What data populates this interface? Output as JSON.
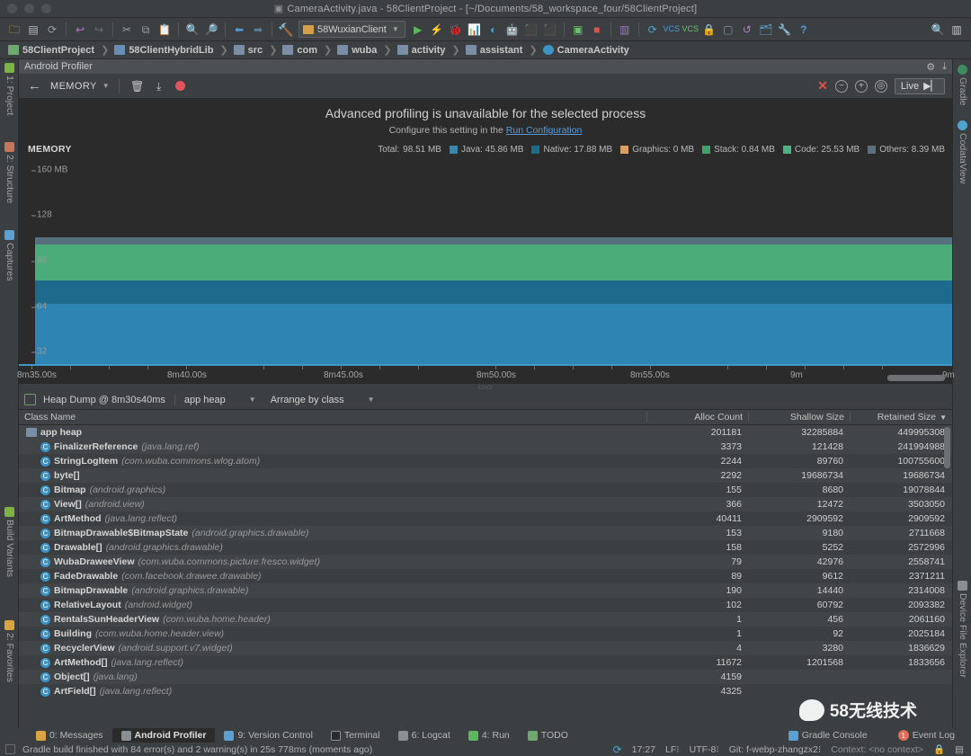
{
  "window": {
    "title": "CameraActivity.java - 58ClientProject - [~/Documents/58_workspace_four/58ClientProject]",
    "doc_icon": "document-icon"
  },
  "toolbar": {
    "icons": [
      "open-folder-icon",
      "save-icon",
      "sync-icon",
      "undo-icon",
      "redo-icon",
      "cut-icon",
      "copy-icon",
      "paste-icon",
      "find-icon",
      "find-replace-icon",
      "back-icon",
      "forward-icon",
      "build-icon"
    ],
    "run_config": "58WuxianClient",
    "right_icons": [
      "search-icon",
      "avatar-icon"
    ],
    "action_icons": [
      "run-icon",
      "apply-changes-icon",
      "debug-icon",
      "profile-icon",
      "monitor-icon",
      "android-icon",
      "sdk-manager-icon",
      "avd-manager-icon",
      "stop-icon",
      "layout-inspector-icon",
      "sync-gradle-icon",
      "vcs-update-icon",
      "vcs-commit-icon",
      "lock-icon",
      "device-icon",
      "revert-icon",
      "project-structure-icon",
      "settings-icon",
      "help-icon"
    ]
  },
  "breadcrumb": [
    {
      "label": "58ClientProject",
      "icon": "module-icon"
    },
    {
      "label": "58ClientHybridLib",
      "icon": "library-icon"
    },
    {
      "label": "src",
      "icon": "source-folder-icon"
    },
    {
      "label": "com",
      "icon": "folder-icon"
    },
    {
      "label": "wuba",
      "icon": "folder-icon"
    },
    {
      "label": "activity",
      "icon": "folder-icon"
    },
    {
      "label": "assistant",
      "icon": "folder-icon"
    },
    {
      "label": "CameraActivity",
      "icon": "class-icon"
    }
  ],
  "left_rail": [
    {
      "label": "1: Project",
      "icon": "project-icon"
    },
    {
      "label": "2: Structure",
      "icon": "structure-icon"
    },
    {
      "label": "Captures",
      "icon": "captures-icon"
    },
    {
      "label": "Build Variants",
      "icon": "build-variants-icon"
    },
    {
      "label": "2: Favorites",
      "icon": "favorites-icon"
    }
  ],
  "right_rail": [
    {
      "label": "Gradle",
      "icon": "gradle-icon"
    },
    {
      "label": "CodataView",
      "icon": "codata-icon"
    },
    {
      "label": "Device File Explorer",
      "icon": "device-file-explorer-icon"
    }
  ],
  "panel": {
    "title": "Android Profiler",
    "gear_icon": "settings-icon",
    "hide_icon": "hide-icon"
  },
  "profiler_toolbar": {
    "back_icon": "back-arrow-icon",
    "mode": "MEMORY",
    "dropdown_icon": "chevron-down-icon",
    "trash_icon": "trash-icon",
    "export_icon": "export-heap-dump-icon",
    "record_icon": "record-icon",
    "close_icon": "close-icon",
    "zoom_out_icon": "zoom-out-icon",
    "zoom_in_icon": "zoom-in-icon",
    "reset_zoom_icon": "reset-zoom-icon",
    "live_label": "Live",
    "live_icon": "go-live-icon"
  },
  "banner": {
    "message": "Advanced profiling is unavailable for the selected process",
    "hint_prefix": "Configure this setting in the ",
    "hint_link": "Run Configuration"
  },
  "chart_data": {
    "type": "area",
    "title": "MEMORY",
    "xlabel": "",
    "ylabel": "MB",
    "ylim": [
      0,
      160
    ],
    "yticks": [
      160,
      128,
      96,
      64,
      32
    ],
    "ytick_labels": [
      "160 MB",
      "128",
      "96",
      "64",
      "32"
    ],
    "xticks": [
      "8m35.00s",
      "8m40.00s",
      "8m45.00s",
      "8m50.00s",
      "8m55.00s",
      "9m",
      "9m"
    ],
    "grid": false,
    "legend_position": "top-right",
    "total_label": "Total:",
    "total_value": "98.51 MB",
    "series": [
      {
        "name": "Java",
        "label": "Java: 45.86 MB",
        "value": 45.86,
        "color": "#3d85a8"
      },
      {
        "name": "Native",
        "label": "Native: 17.88 MB",
        "value": 17.88,
        "color": "#1b6c8c"
      },
      {
        "name": "Graphics",
        "label": "Graphics: 0 MB",
        "value": 0,
        "color": "#d9a066"
      },
      {
        "name": "Stack",
        "label": "Stack: 0.84 MB",
        "value": 0.84,
        "color": "#43a06f"
      },
      {
        "name": "Code",
        "label": "Code: 25.53 MB",
        "value": 25.53,
        "color": "#4fb083"
      },
      {
        "name": "Others",
        "label": "Others: 8.39 MB",
        "value": 8.39,
        "color": "#5b7080"
      }
    ],
    "stack_bands": [
      {
        "name": "Java",
        "from": 0,
        "to": 47,
        "color": "#2e84b3"
      },
      {
        "name": "Native",
        "from": 47,
        "to": 65,
        "color": "#1d6a8c"
      },
      {
        "name": "Code",
        "from": 65,
        "to": 93,
        "color": "#4bab79"
      },
      {
        "name": "Others",
        "from": 93,
        "to": 98,
        "color": "#56707e"
      }
    ]
  },
  "heap_bar": {
    "icon": "heap-dump-icon",
    "title": "Heap Dump @ 8m30s40ms",
    "heap_select": "app heap",
    "arrange_select": "Arrange by class",
    "caret_icon": "chevron-down-icon"
  },
  "table": {
    "columns": [
      "Class Name",
      "Alloc Count",
      "Shallow Size",
      "Retained Size"
    ],
    "sorted_column": "Retained Size",
    "sort_icon": "sort-desc-icon",
    "root": {
      "name": "app heap",
      "alloc": "201181",
      "shallow": "32285884",
      "retained": "449995308",
      "icon": "heap-folder-icon"
    },
    "rows": [
      {
        "name": "FinalizerReference",
        "pkg": "(java.lang.ref)",
        "alloc": "3373",
        "shallow": "121428",
        "retained": "241994988"
      },
      {
        "name": "StringLogItem",
        "pkg": "(com.wuba.commons.wlog.atom)",
        "alloc": "2244",
        "shallow": "89760",
        "retained": "100755600"
      },
      {
        "name": "byte[]",
        "pkg": "",
        "alloc": "2292",
        "shallow": "19686734",
        "retained": "19686734"
      },
      {
        "name": "Bitmap",
        "pkg": "(android.graphics)",
        "alloc": "155",
        "shallow": "8680",
        "retained": "19078844"
      },
      {
        "name": "View[]",
        "pkg": "(android.view)",
        "alloc": "366",
        "shallow": "12472",
        "retained": "3503050"
      },
      {
        "name": "ArtMethod",
        "pkg": "(java.lang.reflect)",
        "alloc": "40411",
        "shallow": "2909592",
        "retained": "2909592"
      },
      {
        "name": "BitmapDrawable$BitmapState",
        "pkg": "(android.graphics.drawable)",
        "alloc": "153",
        "shallow": "9180",
        "retained": "2711668"
      },
      {
        "name": "Drawable[]",
        "pkg": "(android.graphics.drawable)",
        "alloc": "158",
        "shallow": "5252",
        "retained": "2572996"
      },
      {
        "name": "WubaDraweeView",
        "pkg": "(com.wuba.commons.picture.fresco.widget)",
        "alloc": "79",
        "shallow": "42976",
        "retained": "2558741"
      },
      {
        "name": "FadeDrawable",
        "pkg": "(com.facebook.drawee.drawable)",
        "alloc": "89",
        "shallow": "9612",
        "retained": "2371211"
      },
      {
        "name": "BitmapDrawable",
        "pkg": "(android.graphics.drawable)",
        "alloc": "190",
        "shallow": "14440",
        "retained": "2314008"
      },
      {
        "name": "RelativeLayout",
        "pkg": "(android.widget)",
        "alloc": "102",
        "shallow": "60792",
        "retained": "2093382"
      },
      {
        "name": "RentalsSunHeaderView",
        "pkg": "(com.wuba.home.header)",
        "alloc": "1",
        "shallow": "456",
        "retained": "2061160"
      },
      {
        "name": "Building",
        "pkg": "(com.wuba.home.header.view)",
        "alloc": "1",
        "shallow": "92",
        "retained": "2025184"
      },
      {
        "name": "RecyclerView",
        "pkg": "(android.support.v7.widget)",
        "alloc": "4",
        "shallow": "3280",
        "retained": "1836629"
      },
      {
        "name": "ArtMethod[]",
        "pkg": "(java.lang.reflect)",
        "alloc": "11672",
        "shallow": "1201568",
        "retained": "1833656"
      },
      {
        "name": "Object[]",
        "pkg": "(java.lang)",
        "alloc": "4159",
        "shallow": "",
        "retained": ""
      },
      {
        "name": "ArtField[]",
        "pkg": "(java.lang.reflect)",
        "alloc": "4325",
        "shallow": "",
        "retained": ""
      }
    ]
  },
  "bottom_tabs": [
    {
      "key": "0",
      "label": "0: Messages",
      "icon": "messages-icon",
      "active": false
    },
    {
      "key": "",
      "label": "Android Profiler",
      "icon": "profiler-icon",
      "active": true
    },
    {
      "key": "9",
      "label": "9: Version Control",
      "icon": "version-control-icon",
      "active": false
    },
    {
      "key": "",
      "label": "Terminal",
      "icon": "terminal-icon",
      "active": false
    },
    {
      "key": "6",
      "label": "6: Logcat",
      "icon": "logcat-icon",
      "active": false
    },
    {
      "key": "4",
      "label": "4: Run",
      "icon": "run-icon",
      "active": false
    },
    {
      "key": "",
      "label": "TODO",
      "icon": "todo-icon",
      "active": false
    }
  ],
  "bottom_right_tabs": [
    {
      "label": "Gradle Console",
      "icon": "gradle-console-icon"
    },
    {
      "label": "Event Log",
      "icon": "event-log-icon",
      "badge": "1"
    }
  ],
  "status_bar": {
    "message": "Gradle build finished with 84 error(s) and 2 warning(s) in 25s 778ms (moments ago)",
    "time": "17:27",
    "line_sep": "LF",
    "encoding": "UTF-8",
    "branch": "Git: f-webp-zhangzx2",
    "context": "Context: <no context>",
    "lock_icon": "lock-icon",
    "memory_icon": "memory-indicator-icon",
    "sync_icon": "sync-status-icon"
  },
  "watermark": {
    "text": "58无线技术",
    "icon": "wechat-icon"
  }
}
